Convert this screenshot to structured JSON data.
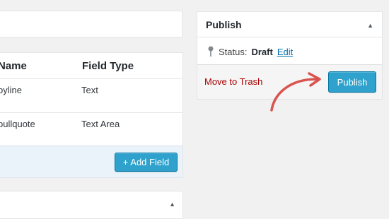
{
  "fields_table": {
    "columns": [
      "Name",
      "Field Type"
    ],
    "rows": [
      {
        "name": "byline",
        "type": "Text"
      },
      {
        "name": "pullquote",
        "type": "Text Area"
      }
    ],
    "add_button": "+ Add Field"
  },
  "publish": {
    "title": "Publish",
    "status_label": "Status:",
    "status_value": "Draft",
    "edit_link": "Edit",
    "trash_link": "Move to Trash",
    "publish_button": "Publish"
  },
  "icons": {
    "toggle": "triangle-up-icon",
    "status": "pin-icon",
    "annotation": "red-curved-arrow-icon"
  },
  "colors": {
    "accent": "#2ea2cc",
    "trash": "#aa0000",
    "link": "#0073aa",
    "annotation_arrow": "#d9534f"
  }
}
